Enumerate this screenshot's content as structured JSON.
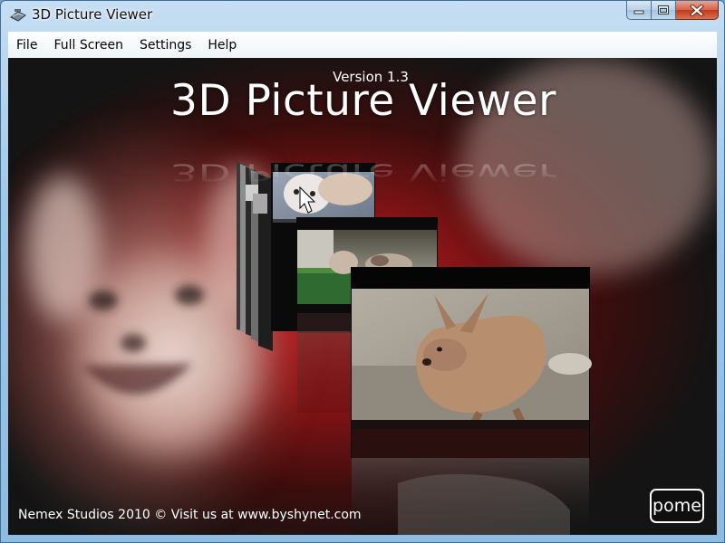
{
  "window": {
    "title": "3D Picture Viewer"
  },
  "menu": {
    "items": [
      "File",
      "Full Screen",
      "Settings",
      "Help"
    ]
  },
  "viewer": {
    "version": "Version 1.3",
    "app_title": "3D Picture Viewer",
    "footer": "Nemex Studios 2010 © Visit us at www.byshynet.com",
    "brand_button": "pome",
    "photos": [
      "dog",
      "cat",
      "kangaroo"
    ]
  },
  "colors": {
    "glow": "#b01414",
    "background": "#151515"
  }
}
